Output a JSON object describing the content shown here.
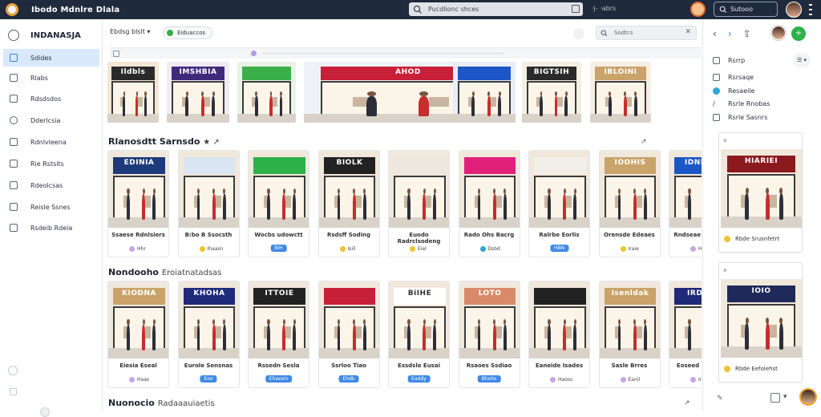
{
  "app": {
    "title": "Ibodo Mdnlre Dlala"
  },
  "topbar": {
    "search_placeholder": "Pucdlionc shces",
    "filter_text": "·j- ·abrs",
    "user_label": "Sutooo",
    "menu_icon": "kebab-menu-icon"
  },
  "sidebar": {
    "header": "INDANASJA",
    "items": [
      {
        "label": "Sdides",
        "active": true,
        "icon": "grid-icon"
      },
      {
        "label": "Rlabs",
        "active": false,
        "icon": "calendar-icon",
        "badge": true
      },
      {
        "label": "Rdsdsdos",
        "active": false,
        "icon": "list-icon"
      },
      {
        "label": "Dderlcsia",
        "active": false,
        "icon": "clock-icon"
      },
      {
        "label": "Rdnlvleena",
        "active": false,
        "icon": "document-icon"
      },
      {
        "label": "Rie Rstsits",
        "active": false,
        "icon": "list-icon"
      },
      {
        "label": "Rdeolcsas",
        "active": false,
        "icon": "calendar-icon"
      },
      {
        "label": "Reisle Ssnes",
        "active": false,
        "icon": "chart-icon"
      },
      {
        "label": "Rsdeib Rdeia",
        "active": false,
        "icon": "box-icon"
      }
    ]
  },
  "main": {
    "crumb": "Ebdsg blslt ▾",
    "chip": "Eiduaccos",
    "search_placeholder": "Sodtcs",
    "search_clear": "✕",
    "sections": [
      {
        "title": "Rlanosdtt Sarnsdo",
        "title_extra": "★ ↗",
        "tools": "↗"
      },
      {
        "title": "Nondooho",
        "title_extra": "Eroiatnatadsas",
        "tools": ""
      },
      {
        "title": "Nuonocio",
        "title_extra": "Radaaauiaetis",
        "tools": "↗"
      }
    ],
    "strip_images": [
      {
        "sign": "Ildbls",
        "sign_color": "#2a2a2a",
        "wall": "#f3e6d4"
      },
      {
        "sign": "IMSHBIA",
        "sign_color": "#3e2a7a",
        "wall": "#f1eaf6"
      },
      {
        "sign": "",
        "sign_color": "#3bb04a",
        "wall": "#e9f3e6"
      },
      {
        "sign": "AHOD",
        "sign_color": "#c9203a",
        "wall": "#eef2f6"
      },
      {
        "sign": "",
        "sign_color": "#1d57c5",
        "wall": "#e7eef8"
      },
      {
        "sign": "BIGTSIH",
        "sign_color": "#2a2a2a",
        "wall": "#f5eee3"
      },
      {
        "sign": "IBLOINI",
        "sign_color": "#c9a36a",
        "wall": "#f6efe3"
      }
    ],
    "row1": [
      {
        "caption": "Ssaese Rdnlsiers",
        "tag": "Hhr",
        "tag_color": "#c7a6e6",
        "sign": "EDINIA",
        "sign_color": "#1f3a7a"
      },
      {
        "caption": "B:bo B Ssocsth",
        "tag": "Ihaasn",
        "tag_color": "#f0c22e",
        "sign": "",
        "sign_color": "#d9e6f2"
      },
      {
        "caption": "Wocbs udowctt",
        "tag": "BIH",
        "tag_color": "#3e8ae6",
        "sign": "",
        "sign_color": "#2db04a",
        "pill": true
      },
      {
        "caption": "Rsdsff Soding",
        "tag": "Isiil",
        "tag_color": "#f0c22e",
        "sign": "BIOLK",
        "sign_color": "#222222"
      },
      {
        "caption": "Euodo Radrclsodeng",
        "tag": "Eiel",
        "tag_color": "#f0c22e",
        "sign": "",
        "sign_color": "#ede7df"
      },
      {
        "caption": "Rado Ohs Bacrg",
        "tag": "Dsbd",
        "tag_color": "#2aa9d6",
        "sign": "",
        "sign_color": "#e0207a"
      },
      {
        "caption": "Ralrbe Eorlis",
        "tag": "HBN",
        "tag_color": "#3e8ae6",
        "sign": "",
        "sign_color": "#f2efe8",
        "pill": true
      },
      {
        "caption": "Orensde Edeaes",
        "tag": "Iraie",
        "tag_color": "#f0c22e",
        "sign": "IOOHIS",
        "sign_color": "#c9a36a"
      },
      {
        "caption": "Rndseae Eaeads",
        "tag": "Hhin",
        "tag_color": "#c7a6e6",
        "sign": "IDNNIA",
        "sign_color": "#1d57c5"
      }
    ],
    "row2": [
      {
        "caption": "Eiesia Eseal",
        "tag": "Haas",
        "tag_color": "#c7a6e6",
        "sign": "KIODNA",
        "sign_color": "#c9a36a"
      },
      {
        "caption": "Eurole Sensnas",
        "tag": "Eoo",
        "tag_color": "#3e8ae6",
        "sign": "KHOHA",
        "sign_color": "#1f2a7a",
        "pill": true
      },
      {
        "caption": "Rssedn Sesla",
        "tag": "Ehaesin",
        "tag_color": "#3e8ae6",
        "sign": "ITTOIE",
        "sign_color": "#222222",
        "pill": true
      },
      {
        "caption": "Ssrloo Tiao",
        "tag": "Ehdk",
        "tag_color": "#3e8ae6",
        "sign": "",
        "sign_color": "#c9203a",
        "pill": true
      },
      {
        "caption": "Essdsle Eusai",
        "tag": "Eaddy",
        "tag_color": "#3e8ae6",
        "sign": "BiIHE",
        "sign_color": "#ffffff",
        "pill": true
      },
      {
        "caption": "Rsaoes Ssdiao",
        "tag": "Bhohs",
        "tag_color": "#3e8ae6",
        "sign": "LOTO",
        "sign_color": "#d98a6a",
        "pill": true
      },
      {
        "caption": "Eaneide Isades",
        "tag": "Haoss",
        "tag_color": "#c7a6e6",
        "sign": "",
        "sign_color": "#222222"
      },
      {
        "caption": "Sasle Brres",
        "tag": "Eanil",
        "tag_color": "#c7a6e6",
        "sign": "Isenldak",
        "sign_color": "#c9a36a"
      },
      {
        "caption": "Eoseed Eeodla",
        "tag": "Inarsi",
        "tag_color": "#c7a6e6",
        "sign": "IRDSE",
        "sign_color": "#1f2a7a"
      }
    ]
  },
  "right": {
    "items": [
      {
        "label": "Rsrrp",
        "icon": "document-icon"
      },
      {
        "label": "Rsrsaqe",
        "icon": "list-icon"
      },
      {
        "label": "Resaeile",
        "icon": "info-circle-icon"
      },
      {
        "label": "Rsrle Rnobas",
        "icon": "pen-icon"
      },
      {
        "label": "Rsrle Sasnrs",
        "icon": "image-icon"
      }
    ],
    "select": "☰ ▾",
    "cards": [
      {
        "header": "✧",
        "sign": "HIARIEI",
        "sign_color": "#8b1a1e",
        "caption": "Rbde Srusnfetrt"
      },
      {
        "header": "✧",
        "sign": "IOIO",
        "sign_color": "#1f2a5a",
        "caption": "Rbde Eefolehst"
      }
    ],
    "bottom_text": "✎",
    "bottom_more": "▾"
  }
}
